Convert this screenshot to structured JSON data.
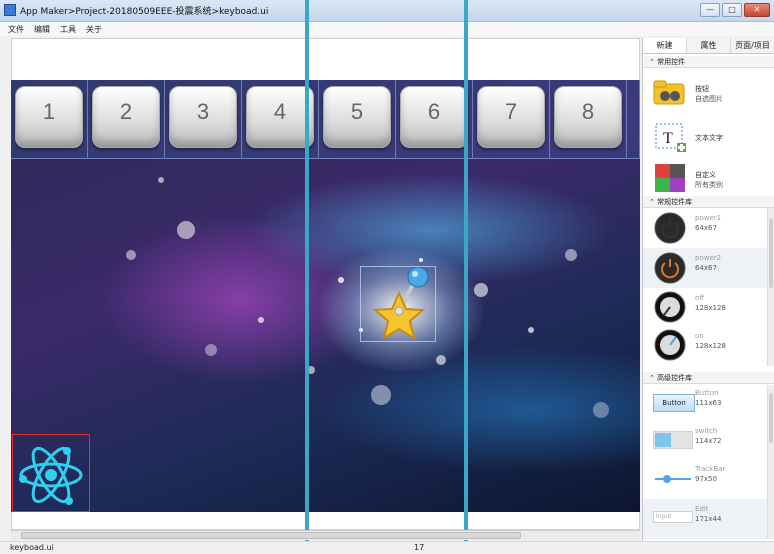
{
  "window": {
    "title": "App Maker>Project-20180509EEE-投震系统>keyboad.ui",
    "min_label": "—",
    "max_label": "□",
    "close_label": "✕"
  },
  "menu": [
    "文件",
    "编辑",
    "工具",
    "关于"
  ],
  "keys": [
    "1",
    "2",
    "3",
    "4",
    "5",
    "6",
    "7",
    "8"
  ],
  "status": {
    "file": "keyboad.ui",
    "page": "17"
  },
  "panel": {
    "tabs": [
      "新建",
      "属性",
      "页面/项目"
    ],
    "common": {
      "header": "常用控件",
      "items": [
        {
          "name": "按钮",
          "sub": "自选图片"
        },
        {
          "name": "文本文字",
          "sub": ""
        },
        {
          "name": "自定义",
          "sub": "所有类别"
        }
      ]
    },
    "library": {
      "header": "常规控件库",
      "items": [
        {
          "name": "power1",
          "size": "64x67"
        },
        {
          "name": "power2",
          "size": "64x67"
        },
        {
          "name": "off",
          "size": "128x128"
        },
        {
          "name": "on",
          "size": "128x128"
        }
      ]
    },
    "advanced": {
      "header": "高级控件库",
      "items": [
        {
          "name": "Button",
          "size": "111x63",
          "preview": "Button"
        },
        {
          "name": "switch",
          "size": "114x72",
          "preview": ""
        },
        {
          "name": "TrackBar",
          "size": "97x50",
          "preview": ""
        },
        {
          "name": "Edit",
          "size": "171x44",
          "preview": "Input"
        }
      ]
    }
  },
  "colors": {
    "overlay_line": "#39a7c5",
    "accent": "#3a7bd5"
  }
}
